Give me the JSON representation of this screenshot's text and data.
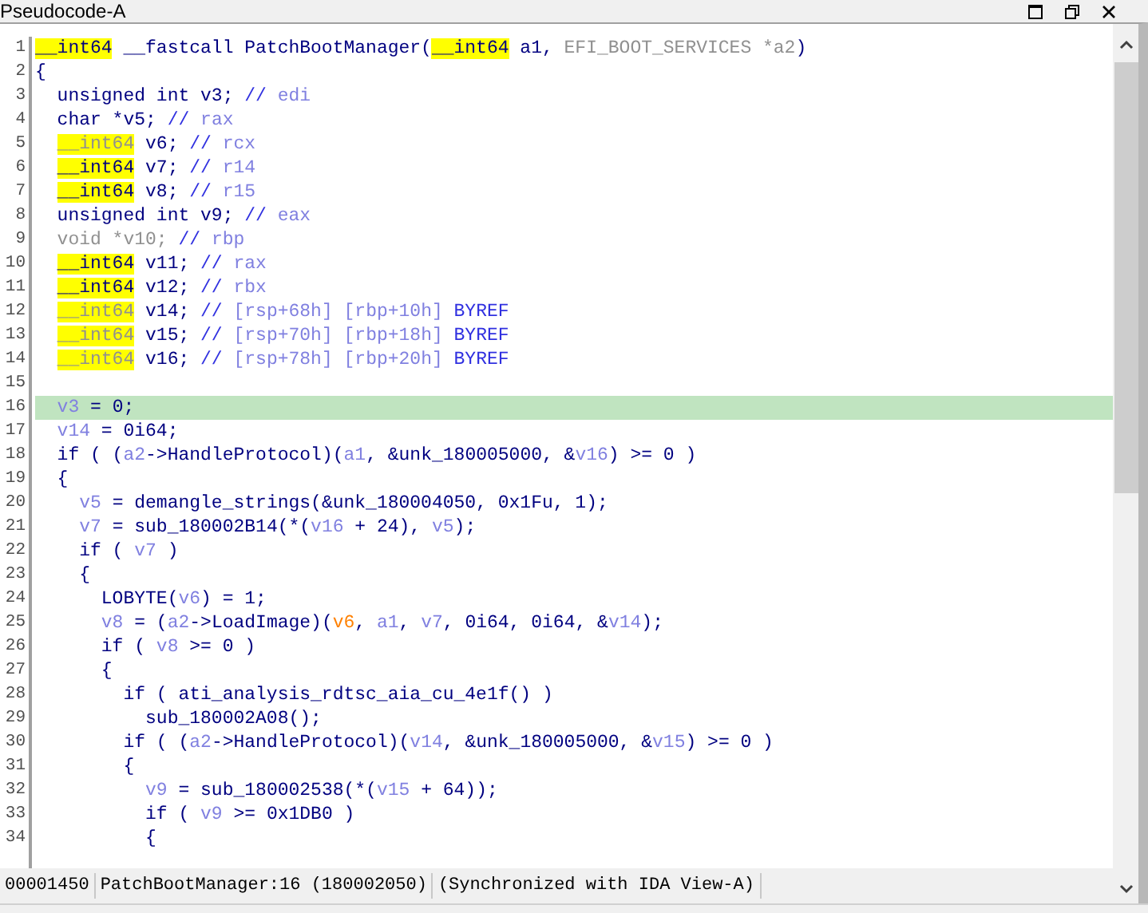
{
  "window": {
    "title": "Pseudocode-A"
  },
  "lines": [
    {
      "no": "1",
      "selected": false,
      "tokens": [
        {
          "t": "__int64",
          "kind": "hl"
        },
        {
          "t": " __fastcall PatchBootManager(",
          "kind": "code"
        },
        {
          "t": "__int64",
          "kind": "hl"
        },
        {
          "t": " a1, ",
          "kind": "code"
        },
        {
          "t": "EFI_BOOT_SERVICES *a2",
          "kind": "dim"
        },
        {
          "t": ")",
          "kind": "code"
        }
      ]
    },
    {
      "no": "2",
      "selected": false,
      "tokens": [
        {
          "t": "{",
          "kind": "code"
        }
      ]
    },
    {
      "no": "3",
      "selected": false,
      "tokens": [
        {
          "t": "  unsigned int v3; ",
          "kind": "code"
        },
        {
          "t": "// ",
          "kind": "comment"
        },
        {
          "t": "edi",
          "kind": "var"
        }
      ]
    },
    {
      "no": "4",
      "selected": false,
      "tokens": [
        {
          "t": "  char *v5; ",
          "kind": "code"
        },
        {
          "t": "// ",
          "kind": "comment"
        },
        {
          "t": "rax",
          "kind": "var"
        }
      ]
    },
    {
      "no": "5",
      "selected": false,
      "tokens": [
        {
          "t": "__int64",
          "kind": "hldim",
          "indented": true
        },
        {
          "t": " v6; ",
          "kind": "code"
        },
        {
          "t": "// ",
          "kind": "comment"
        },
        {
          "t": "rcx",
          "kind": "var"
        }
      ]
    },
    {
      "no": "6",
      "selected": false,
      "tokens": [
        {
          "t": "__int64",
          "kind": "hl",
          "indented": true
        },
        {
          "t": " v7; ",
          "kind": "code"
        },
        {
          "t": "// ",
          "kind": "comment"
        },
        {
          "t": "r14",
          "kind": "var"
        }
      ]
    },
    {
      "no": "7",
      "selected": false,
      "tokens": [
        {
          "t": "__int64",
          "kind": "hl",
          "indented": true
        },
        {
          "t": " v8; ",
          "kind": "code"
        },
        {
          "t": "// ",
          "kind": "comment"
        },
        {
          "t": "r15",
          "kind": "var"
        }
      ]
    },
    {
      "no": "8",
      "selected": false,
      "tokens": [
        {
          "t": "  unsigned int v9; ",
          "kind": "code"
        },
        {
          "t": "// ",
          "kind": "comment"
        },
        {
          "t": "eax",
          "kind": "var"
        }
      ]
    },
    {
      "no": "9",
      "selected": false,
      "tokens": [
        {
          "t": "  void *v10; ",
          "kind": "dim"
        },
        {
          "t": "// ",
          "kind": "comment"
        },
        {
          "t": "rbp",
          "kind": "var"
        }
      ]
    },
    {
      "no": "10",
      "selected": false,
      "tokens": [
        {
          "t": "__int64",
          "kind": "hl",
          "indented": true
        },
        {
          "t": " v11; ",
          "kind": "code"
        },
        {
          "t": "// ",
          "kind": "comment"
        },
        {
          "t": "rax",
          "kind": "var"
        }
      ]
    },
    {
      "no": "11",
      "selected": false,
      "tokens": [
        {
          "t": "__int64",
          "kind": "hl",
          "indented": true
        },
        {
          "t": " v12; ",
          "kind": "code"
        },
        {
          "t": "// ",
          "kind": "comment"
        },
        {
          "t": "rbx",
          "kind": "var"
        }
      ]
    },
    {
      "no": "12",
      "selected": false,
      "tokens": [
        {
          "t": "__int64",
          "kind": "hldim",
          "indented": true
        },
        {
          "t": " v14; ",
          "kind": "code"
        },
        {
          "t": "// ",
          "kind": "comment"
        },
        {
          "t": "[rsp+68h] [rbp+10h] ",
          "kind": "var"
        },
        {
          "t": "BYREF",
          "kind": "comment"
        }
      ]
    },
    {
      "no": "13",
      "selected": false,
      "tokens": [
        {
          "t": "__int64",
          "kind": "hldim",
          "indented": true
        },
        {
          "t": " v15; ",
          "kind": "code"
        },
        {
          "t": "// ",
          "kind": "comment"
        },
        {
          "t": "[rsp+70h] [rbp+18h] ",
          "kind": "var"
        },
        {
          "t": "BYREF",
          "kind": "comment"
        }
      ]
    },
    {
      "no": "14",
      "selected": false,
      "tokens": [
        {
          "t": "__int64",
          "kind": "hldim",
          "indented": true
        },
        {
          "t": " v16; ",
          "kind": "code"
        },
        {
          "t": "// ",
          "kind": "comment"
        },
        {
          "t": "[rsp+78h] [rbp+20h] ",
          "kind": "var"
        },
        {
          "t": "BYREF",
          "kind": "comment"
        }
      ]
    },
    {
      "no": "15",
      "selected": false
    },
    {
      "no": "16",
      "selected": true,
      "tokens": [
        {
          "t": "  v3",
          "kind": "var"
        },
        {
          "t": " = 0;",
          "kind": "code"
        }
      ]
    },
    {
      "no": "17",
      "selected": false,
      "tokens": [
        {
          "t": "  v14",
          "kind": "var"
        },
        {
          "t": " = 0i64;",
          "kind": "code"
        }
      ]
    },
    {
      "no": "18",
      "selected": false,
      "tokens": [
        {
          "t": "  if ( (",
          "kind": "code"
        },
        {
          "t": "a2",
          "kind": "var"
        },
        {
          "t": "->HandleProtocol)(",
          "kind": "code"
        },
        {
          "t": "a1",
          "kind": "var"
        },
        {
          "t": ", &unk_180005000, &",
          "kind": "code"
        },
        {
          "t": "v16",
          "kind": "var"
        },
        {
          "t": ") >= 0 )",
          "kind": "code"
        }
      ]
    },
    {
      "no": "19",
      "selected": false,
      "tokens": [
        {
          "t": "  {",
          "kind": "code"
        }
      ]
    },
    {
      "no": "20",
      "selected": false,
      "tokens": [
        {
          "t": "    v5",
          "kind": "var"
        },
        {
          "t": " = demangle_strings(&unk_180004050, 0x1Fu, 1);",
          "kind": "code"
        }
      ]
    },
    {
      "no": "21",
      "selected": false,
      "tokens": [
        {
          "t": "    v7",
          "kind": "var"
        },
        {
          "t": " = sub_180002B14(*(",
          "kind": "code"
        },
        {
          "t": "v16",
          "kind": "var"
        },
        {
          "t": " + 24), ",
          "kind": "code"
        },
        {
          "t": "v5",
          "kind": "var"
        },
        {
          "t": ");",
          "kind": "code"
        }
      ]
    },
    {
      "no": "22",
      "selected": false,
      "tokens": [
        {
          "t": "    if ( ",
          "kind": "code"
        },
        {
          "t": "v7",
          "kind": "var"
        },
        {
          "t": " )",
          "kind": "code"
        }
      ]
    },
    {
      "no": "23",
      "selected": false,
      "tokens": [
        {
          "t": "    {",
          "kind": "code"
        }
      ]
    },
    {
      "no": "24",
      "selected": false,
      "tokens": [
        {
          "t": "      LOBYTE(",
          "kind": "code"
        },
        {
          "t": "v6",
          "kind": "var"
        },
        {
          "t": ") = 1;",
          "kind": "code"
        }
      ]
    },
    {
      "no": "25",
      "selected": false,
      "tokens": [
        {
          "t": "      v8",
          "kind": "var"
        },
        {
          "t": " = (",
          "kind": "code"
        },
        {
          "t": "a2",
          "kind": "var"
        },
        {
          "t": "->LoadImage)(",
          "kind": "code"
        },
        {
          "t": "v6",
          "kind": "orange"
        },
        {
          "t": ", ",
          "kind": "code"
        },
        {
          "t": "a1",
          "kind": "var"
        },
        {
          "t": ", ",
          "kind": "code"
        },
        {
          "t": "v7",
          "kind": "var"
        },
        {
          "t": ", 0i64, 0i64, &",
          "kind": "code"
        },
        {
          "t": "v14",
          "kind": "var"
        },
        {
          "t": ");",
          "kind": "code"
        }
      ]
    },
    {
      "no": "26",
      "selected": false,
      "tokens": [
        {
          "t": "      if ( ",
          "kind": "code"
        },
        {
          "t": "v8",
          "kind": "var"
        },
        {
          "t": " >= 0 )",
          "kind": "code"
        }
      ]
    },
    {
      "no": "27",
      "selected": false,
      "tokens": [
        {
          "t": "      {",
          "kind": "code"
        }
      ]
    },
    {
      "no": "28",
      "selected": false,
      "tokens": [
        {
          "t": "        if ( ati_analysis_rdtsc_aia_cu_4e1f() )",
          "kind": "code"
        }
      ]
    },
    {
      "no": "29",
      "selected": false,
      "tokens": [
        {
          "t": "          sub_180002A08();",
          "kind": "code"
        }
      ]
    },
    {
      "no": "30",
      "selected": false,
      "tokens": [
        {
          "t": "        if ( (",
          "kind": "code"
        },
        {
          "t": "a2",
          "kind": "var"
        },
        {
          "t": "->HandleProtocol)(",
          "kind": "code"
        },
        {
          "t": "v14",
          "kind": "var"
        },
        {
          "t": ", &unk_180005000, &",
          "kind": "code"
        },
        {
          "t": "v15",
          "kind": "var"
        },
        {
          "t": ") >= 0 )",
          "kind": "code"
        }
      ]
    },
    {
      "no": "31",
      "selected": false,
      "tokens": [
        {
          "t": "        {",
          "kind": "code"
        }
      ]
    },
    {
      "no": "32",
      "selected": false,
      "tokens": [
        {
          "t": "          v9",
          "kind": "var"
        },
        {
          "t": " = sub_180002538(*(",
          "kind": "code"
        },
        {
          "t": "v15",
          "kind": "var"
        },
        {
          "t": " + 64));",
          "kind": "code"
        }
      ]
    },
    {
      "no": "33",
      "selected": false,
      "tokens": [
        {
          "t": "          if ( ",
          "kind": "code"
        },
        {
          "t": "v9",
          "kind": "var"
        },
        {
          "t": " >= 0x1DB0 )",
          "kind": "code"
        }
      ]
    },
    {
      "no": "34",
      "selected": false,
      "tokens": [
        {
          "t": "          {",
          "kind": "code"
        }
      ]
    }
  ],
  "status_bar": [
    "00001450",
    "PatchBootManager:16 (180002050)",
    "(Synchronized with IDA View-A)"
  ]
}
